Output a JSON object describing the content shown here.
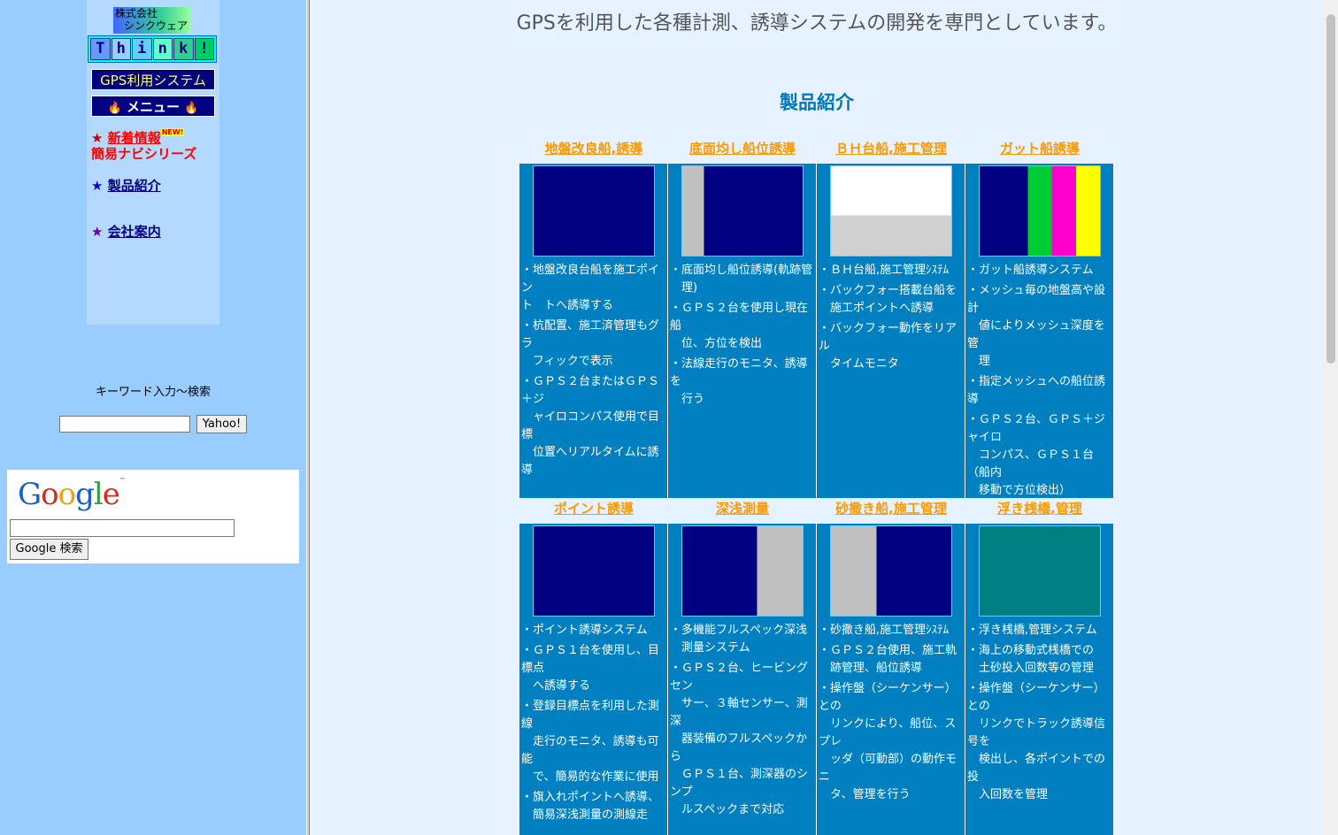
{
  "sidebar": {
    "company_logo_line1": "株式会社",
    "company_logo_line2": "シンクウェア",
    "think_letters": [
      "T",
      "h",
      "i",
      "n",
      "k",
      "!"
    ],
    "gps_system_label": "GPS利用システム",
    "menu_label": "メニュー",
    "nav": [
      {
        "label": "新着情報",
        "color": "#ff0000",
        "badge": "NEW!"
      },
      {
        "label": "簡易ナビシリーズ",
        "color": "#ff0000"
      },
      {
        "label": "製品紹介",
        "color": "#0000cc"
      },
      {
        "label": "会社案内",
        "color": "#0000cc"
      }
    ],
    "star": "★",
    "keyword_label": "キーワード入力～検索",
    "yahoo_button": "Yahoo!",
    "google_logo": "Google",
    "google_button": "Google 検索"
  },
  "main": {
    "tagline": "GPSを利用した各種計測、誘導システムの開発を専門としています。",
    "section_title": "製品紹介",
    "products": [
      {
        "title": "地盤改良船,誘導",
        "desc": [
          "・地盤改良台船を施工ポイン\nト　トへ誘導する",
          "・杭配置、施工済管理もグラ\n　フィックで表示",
          "・ＧＰＳ２台またはＧＰＳ＋ジ\n　ャイロコンパス使用で目標\n　位置へリアルタイムに誘導"
        ]
      },
      {
        "title": "底面均し船位誘導",
        "desc": [
          "・底面均し船位誘導(軌跡管\n　理)",
          "・ＧＰＳ２台を使用し現在船\n　位、方位を検出",
          "・法線走行のモニタ、誘導を\n　行う"
        ]
      },
      {
        "title": "ＢＨ台船,施工管理",
        "desc": [
          "・ＢＨ台船,施工管理ｼｽﾃﾑ",
          "・バックフォー搭載台船を\n　施工ポイントへ誘導",
          "・バックフォー動作をリアル\n　タイムモニタ"
        ]
      },
      {
        "title": "ガット船誘導",
        "desc": [
          "・ガット船誘導システム",
          "・メッシュ毎の地盤高や設計\n　値によりメッシュ深度を管\n　理",
          "・指定メッシュへの船位誘導",
          "・ＧＰＳ２台、ＧＰＳ＋ジャイロ\n　コンパス、ＧＰＳ１台（船内\n　移動で方位検出）"
        ]
      },
      {
        "title": "ポイント誘導",
        "desc": [
          "・ポイント誘導システム",
          "・ＧＰＳ１台を使用し、目標点\n　へ誘導する",
          "・登録目標点を利用した測線\n　走行のモニタ、誘導も可能\n　で、簡易的な作業に使用",
          "・旗入れポイントへ誘導、\n　簡易深浅測量の測線走"
        ]
      },
      {
        "title": "深浅測量",
        "desc": [
          "・多機能フルスペック深浅\n　測量システム",
          "・ＧＰＳ２台、ヒービングセン\n　サー、３軸センサー、測深\n　器装備のフルスペックから\n　ＧＰＳ１台、測深器のシンプ\n　ルスペックまで対応"
        ]
      },
      {
        "title": "砂撒き船,施工管理",
        "desc": [
          "・砂撒き船,施工管理ｼｽﾃﾑ",
          "・ＧＰＳ２台使用、施工軌\n　跡管理、船位誘導",
          "・操作盤（シーケンサー）との\n　リンクにより、船位、スプレ\n　ッダ（可動部）の動作モニ\n　タ、管理を行う"
        ]
      },
      {
        "title": "浮き桟橋,管理",
        "desc": [
          "・浮き桟橋,管理システム",
          "・海上の移動式桟橋での\n　土砂投入回数等の管理",
          "・操作盤（シーケンサー）との\n　リンクでトラック誘導信号を\n　検出し、各ポイントでの投\n　入回数を管理"
        ]
      }
    ]
  },
  "colors": {
    "sidebar_bg": "#99ccff",
    "main_bg": "#e6f2ff",
    "product_bg": "#0080c0",
    "product_title": "#ff9900",
    "section_title": "#0077bb"
  }
}
